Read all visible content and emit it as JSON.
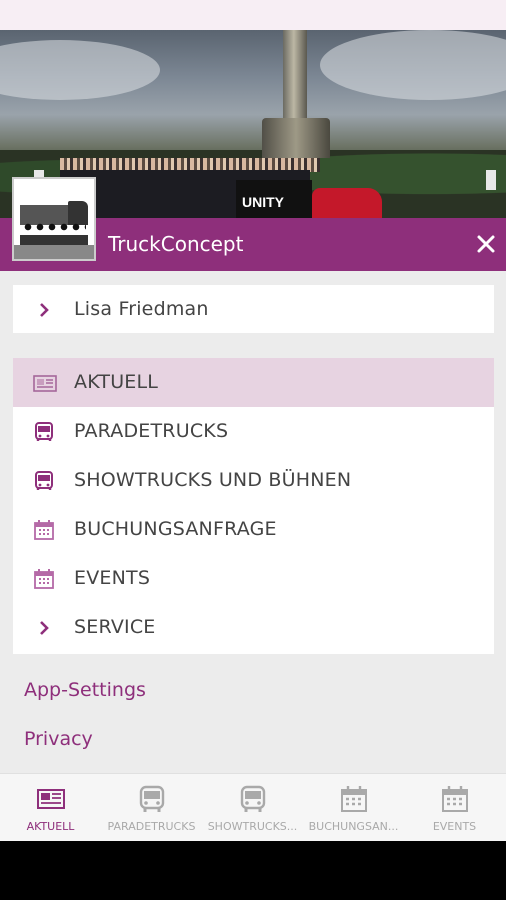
{
  "colors": {
    "accent": "#8e2f7b",
    "active_row": "#e7d3e1",
    "tab_inactive": "#a9a9a9"
  },
  "app": {
    "title": "TruckConcept",
    "logo_text": "TruckConcept"
  },
  "user": {
    "name": "Lisa Friedman",
    "icon": "chevron-right-icon"
  },
  "menu": {
    "items": [
      {
        "label": "AKTUELL",
        "icon": "newspaper-icon",
        "active": true
      },
      {
        "label": "PARADETRUCKS",
        "icon": "bus-icon",
        "active": false
      },
      {
        "label": "SHOWTRUCKS UND BÜHNEN",
        "icon": "bus-icon",
        "active": false
      },
      {
        "label": "BUCHUNGSANFRAGE",
        "icon": "calendar-icon",
        "active": false
      },
      {
        "label": "EVENTS",
        "icon": "calendar-icon",
        "active": false
      },
      {
        "label": "SERVICE",
        "icon": "chevron-right-icon",
        "active": false
      }
    ]
  },
  "links": {
    "settings": "App-Settings",
    "privacy": "Privacy"
  },
  "tabs": [
    {
      "label": "AKTUELL",
      "icon": "newspaper-icon",
      "active": true
    },
    {
      "label": "PARADETRUCKS",
      "icon": "bus-icon",
      "active": false
    },
    {
      "label": "SHOWTRUCKS...",
      "icon": "bus-icon",
      "active": false
    },
    {
      "label": "BUCHUNGSAN...",
      "icon": "calendar-icon",
      "active": false
    },
    {
      "label": "EVENTS",
      "icon": "calendar-icon",
      "active": false
    }
  ],
  "hero": {
    "banner_text": "UNITY"
  }
}
